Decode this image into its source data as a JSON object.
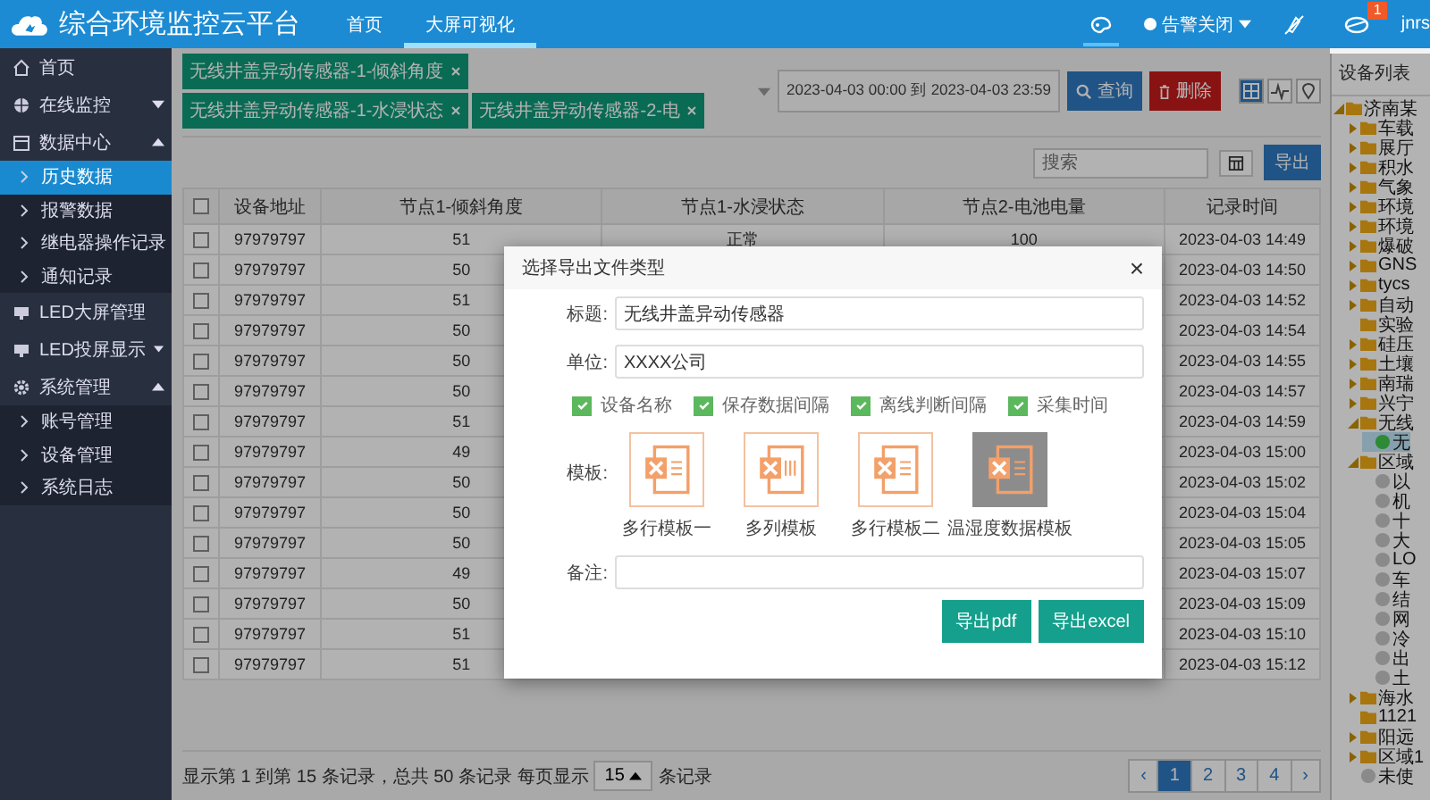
{
  "header": {
    "title": "综合环境监控云平台",
    "nav": [
      {
        "label": "首页",
        "selected": false
      },
      {
        "label": "大屏可视化",
        "selected": true
      }
    ],
    "alarm_toggle": "告警关闭",
    "notification_count": "1",
    "user": "jnrs"
  },
  "sidebar": [
    {
      "label": "首页"
    },
    {
      "label": "在线监控",
      "expanded": false
    },
    {
      "label": "数据中心",
      "expanded": true,
      "children": [
        {
          "label": "历史数据",
          "selected": true
        },
        {
          "label": "报警数据",
          "selected": false
        },
        {
          "label": "继电器操作记录",
          "selected": false
        },
        {
          "label": "通知记录",
          "selected": false
        }
      ]
    },
    {
      "label": "LED大屏管理"
    },
    {
      "label": "LED投屏显示",
      "expanded": false
    },
    {
      "label": "系统管理",
      "expanded": true,
      "children": [
        {
          "label": "账号管理",
          "selected": false
        },
        {
          "label": "设备管理",
          "selected": false
        },
        {
          "label": "系统日志",
          "selected": false
        }
      ]
    }
  ],
  "filters": {
    "tags": [
      "无线井盖异动传感器-1-倾斜角度",
      "无线井盖异动传感器-1-水浸状态",
      "无线井盖异动传感器-2-电"
    ],
    "date_range": "2023-04-03 00:00 到 2023-04-03 23:59",
    "query_button": "查询",
    "delete_button": "删除"
  },
  "toolbar": {
    "search_placeholder": "搜索",
    "export_button": "导出"
  },
  "table": {
    "all_checked": false,
    "columns": [
      "设备地址",
      "节点1-倾斜角度",
      "节点1-水浸状态",
      "节点2-电池电量",
      "记录时间"
    ],
    "rows": [
      {
        "checked": false,
        "address": "97979797",
        "tilt": "51",
        "water": "正常",
        "battery": "100",
        "time": "2023-04-03 14:49"
      },
      {
        "checked": false,
        "address": "97979797",
        "tilt": "50",
        "time": "2023-04-03 14:50"
      },
      {
        "checked": false,
        "address": "97979797",
        "tilt": "51",
        "time": "2023-04-03 14:52"
      },
      {
        "checked": false,
        "address": "97979797",
        "tilt": "50",
        "time": "2023-04-03 14:54"
      },
      {
        "checked": false,
        "address": "97979797",
        "tilt": "50",
        "time": "2023-04-03 14:55"
      },
      {
        "checked": false,
        "address": "97979797",
        "tilt": "50",
        "time": "2023-04-03 14:57"
      },
      {
        "checked": false,
        "address": "97979797",
        "tilt": "51",
        "time": "2023-04-03 14:59"
      },
      {
        "checked": false,
        "address": "97979797",
        "tilt": "49",
        "time": "2023-04-03 15:00"
      },
      {
        "checked": false,
        "address": "97979797",
        "tilt": "50",
        "time": "2023-04-03 15:02"
      },
      {
        "checked": false,
        "address": "97979797",
        "tilt": "50",
        "time": "2023-04-03 15:04"
      },
      {
        "checked": false,
        "address": "97979797",
        "tilt": "50",
        "time": "2023-04-03 15:05"
      },
      {
        "checked": false,
        "address": "97979797",
        "tilt": "49",
        "time": "2023-04-03 15:07"
      },
      {
        "checked": false,
        "address": "97979797",
        "tilt": "50",
        "time": "2023-04-03 15:09"
      },
      {
        "checked": false,
        "address": "97979797",
        "tilt": "51",
        "time": "2023-04-03 15:10"
      },
      {
        "checked": false,
        "address": "97979797",
        "tilt": "51",
        "time": "2023-04-03 15:12"
      }
    ]
  },
  "footer": {
    "summary": "显示第 1 到第 15 条记录，总共 50 条记录 每页显示",
    "page_size": "15",
    "suffix": "条记录",
    "prev": "‹",
    "next": "›",
    "pages": [
      {
        "label": "1",
        "selected": true
      },
      {
        "label": "2",
        "selected": false
      },
      {
        "label": "3",
        "selected": false
      },
      {
        "label": "4",
        "selected": false
      }
    ]
  },
  "device_panel": {
    "title": "设备列表",
    "tree": [
      {
        "kind": "folder",
        "label": "济南某",
        "expanded": true,
        "selected": false,
        "children": [
          {
            "kind": "folder",
            "label": "车载",
            "expanded": false,
            "selected": false
          },
          {
            "kind": "folder",
            "label": "展厅",
            "expanded": false,
            "selected": false
          },
          {
            "kind": "folder",
            "label": "积水",
            "expanded": false,
            "selected": false
          },
          {
            "kind": "folder",
            "label": "气象",
            "expanded": false,
            "selected": false
          },
          {
            "kind": "folder",
            "label": "环境",
            "expanded": false,
            "selected": false
          },
          {
            "kind": "folder",
            "label": "环境",
            "expanded": false,
            "selected": false
          },
          {
            "kind": "folder",
            "label": "爆破",
            "expanded": false,
            "selected": false
          },
          {
            "kind": "folder",
            "label": "GNS",
            "expanded": false,
            "selected": false
          },
          {
            "kind": "folder",
            "label": "tycs",
            "expanded": false,
            "selected": false
          },
          {
            "kind": "folder",
            "label": "自动",
            "expanded": false,
            "selected": false
          },
          {
            "kind": "folder",
            "label": "实验",
            "selected": false
          },
          {
            "kind": "folder",
            "label": "硅压",
            "expanded": false,
            "selected": false
          },
          {
            "kind": "folder",
            "label": "土壤",
            "expanded": false,
            "selected": false
          },
          {
            "kind": "folder",
            "label": "南瑞",
            "expanded": false,
            "selected": false
          },
          {
            "kind": "folder",
            "label": "兴宁",
            "expanded": false,
            "selected": false
          },
          {
            "kind": "folder",
            "label": "无线",
            "expanded": true,
            "selected": false,
            "children": [
              {
                "kind": "device",
                "label": "无",
                "color": "#2e8a34",
                "selected": true
              }
            ]
          },
          {
            "kind": "folder",
            "label": "区域",
            "expanded": true,
            "selected": false,
            "children": [
              {
                "kind": "device",
                "label": "以",
                "color": "#8a8a8a",
                "selected": false
              },
              {
                "kind": "device",
                "label": "机",
                "color": "#8a8a8a",
                "selected": false
              },
              {
                "kind": "device",
                "label": "十",
                "color": "#8a8a8a",
                "selected": false
              },
              {
                "kind": "device",
                "label": "大",
                "color": "#8a8a8a",
                "selected": false
              },
              {
                "kind": "device",
                "label": "LO",
                "color": "#8a8a8a",
                "selected": false
              },
              {
                "kind": "device",
                "label": "车",
                "color": "#8a8a8a",
                "selected": false
              },
              {
                "kind": "device",
                "label": "结",
                "color": "#8a8a8a",
                "selected": false
              },
              {
                "kind": "device",
                "label": "网",
                "color": "#8a8a8a",
                "selected": false
              },
              {
                "kind": "device",
                "label": "冷",
                "color": "#8a8a8a",
                "selected": false
              },
              {
                "kind": "device",
                "label": "出",
                "color": "#8a8a8a",
                "selected": false
              },
              {
                "kind": "device",
                "label": "土",
                "color": "#8a8a8a",
                "selected": false
              }
            ]
          },
          {
            "kind": "folder",
            "label": "海水",
            "expanded": false,
            "selected": false
          },
          {
            "kind": "folder",
            "label": "1121",
            "selected": false
          },
          {
            "kind": "folder",
            "label": "阳远",
            "expanded": false,
            "selected": false
          },
          {
            "kind": "folder",
            "label": "区域1",
            "expanded": false,
            "selected": false
          },
          {
            "kind": "device",
            "label": "未使",
            "color": "#8a8a8a",
            "selected": false
          }
        ]
      }
    ]
  },
  "modal": {
    "title": "选择导出文件类型",
    "close": "×",
    "fields": [
      {
        "label": "标题:",
        "value": "无线井盖异动传感器"
      },
      {
        "label": "单位:",
        "value": "XXXX公司"
      }
    ],
    "options": [
      {
        "label": "设备名称",
        "checked": true
      },
      {
        "label": "保存数据间隔",
        "checked": true
      },
      {
        "label": "离线判断间隔",
        "checked": true
      },
      {
        "label": "采集时间",
        "checked": true
      }
    ],
    "template_label": "模板:",
    "templates": [
      {
        "label": "多行模板一",
        "selected": false
      },
      {
        "label": "多列模板",
        "selected": false
      },
      {
        "label": "多行模板二",
        "selected": false
      },
      {
        "label": "温湿度数据模板",
        "selected": true
      }
    ],
    "remark_label": "备注:",
    "buttons": [
      "导出pdf",
      "导出excel"
    ]
  }
}
